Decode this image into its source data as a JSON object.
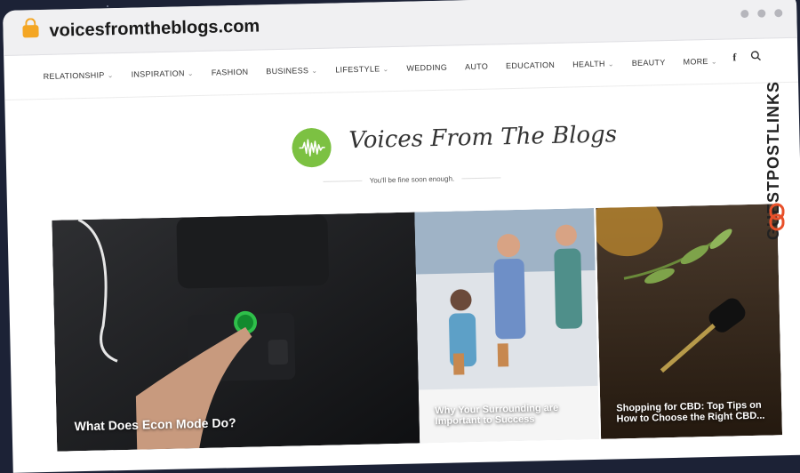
{
  "browser": {
    "url": "voicesfromtheblogs.com"
  },
  "nav": {
    "items": [
      {
        "label": "RELATIONSHIP",
        "chevron": true
      },
      {
        "label": "INSPIRATION",
        "chevron": true
      },
      {
        "label": "FASHION",
        "chevron": false
      },
      {
        "label": "BUSINESS",
        "chevron": true
      },
      {
        "label": "LIFESTYLE",
        "chevron": true
      },
      {
        "label": "WEDDING",
        "chevron": false
      },
      {
        "label": "AUTO",
        "chevron": false
      },
      {
        "label": "EDUCATION",
        "chevron": false
      },
      {
        "label": "HEALTH",
        "chevron": true
      },
      {
        "label": "BEAUTY",
        "chevron": false
      },
      {
        "label": "MORE",
        "chevron": true
      }
    ],
    "icons": [
      "facebook-icon",
      "search-icon"
    ]
  },
  "logo": {
    "text": "Voices From The Blogs",
    "accent": "#7cc142"
  },
  "tagline": "You'll be fine soon enough.",
  "posts": [
    {
      "title": "What Does Econ Mode Do?",
      "image": "car-dashboard-econ-button"
    },
    {
      "title": "Why Your Surrounding are Important to Success",
      "image": "team-high-five-office"
    },
    {
      "title": "Shopping for CBD: Top Tips on How to Choose the Right CBD...",
      "image": "cbd-oil-dropper"
    }
  ],
  "watermark": {
    "text": "GUESTPOSTLINKS",
    "accent": "#e8502a"
  }
}
